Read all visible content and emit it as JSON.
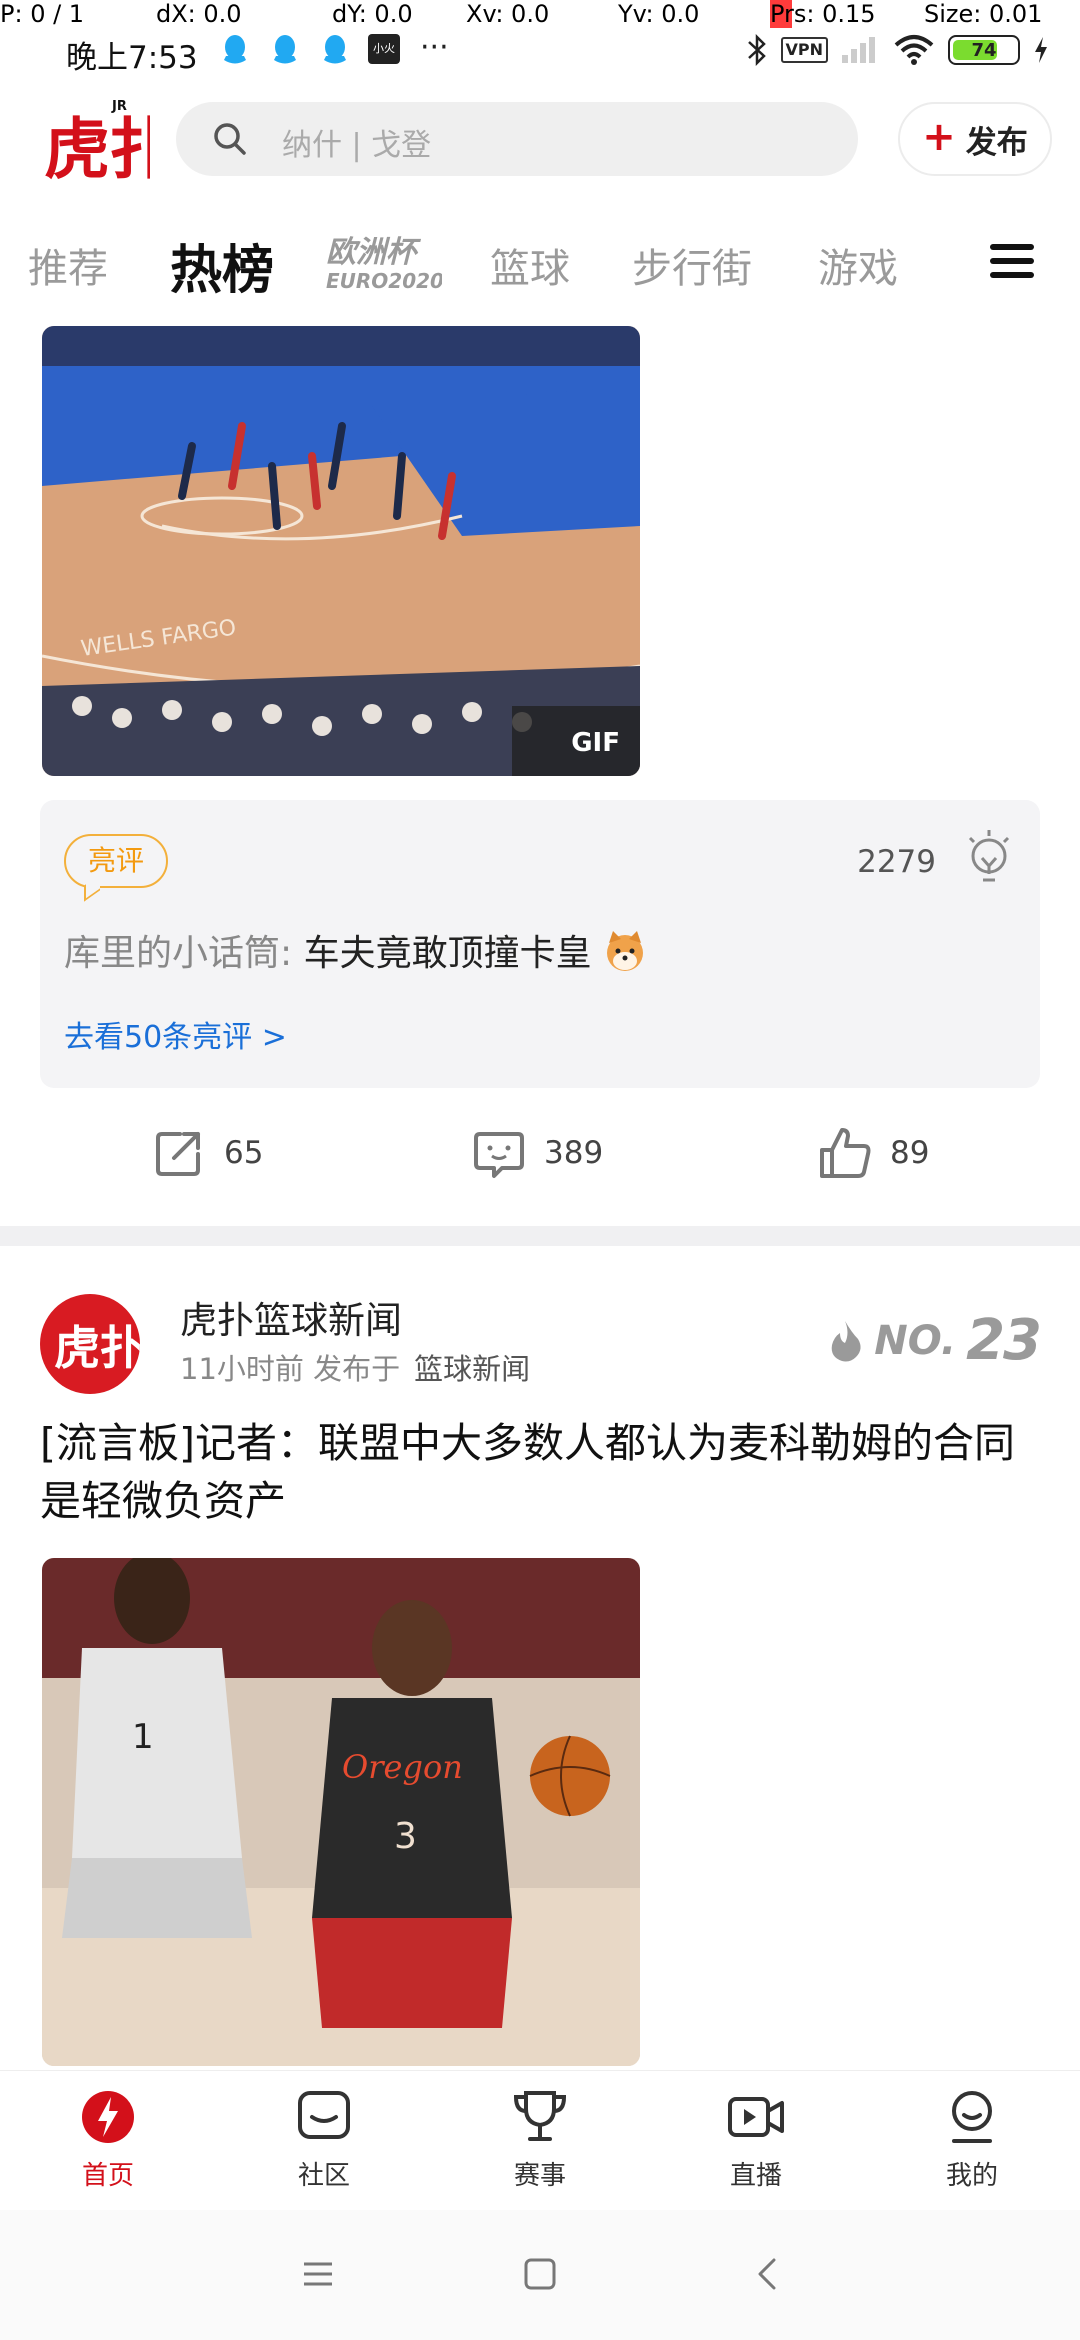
{
  "debug": {
    "p": "P: 0 / 1",
    "dx": "dX: 0.0",
    "dy": "dY: 0.0",
    "xv": "Xv: 0.0",
    "yv": "Yv: 0.0",
    "prs": "Prs: 0.15",
    "size": "Size: 0.01"
  },
  "status": {
    "time": "晚上7:53",
    "more": "···",
    "vpn": "VPN",
    "battery": "74",
    "battery_level": 0.74,
    "app_badge": "小火"
  },
  "header": {
    "logo_text": "虎扑",
    "logo_sup": "JR",
    "search_placeholder": "纳什 | 戈登",
    "publish_label": "发布",
    "publish_plus": "+"
  },
  "tabs": [
    {
      "label": "推荐",
      "active": false
    },
    {
      "label": "热榜",
      "active": true
    },
    {
      "label": "欧洲杯",
      "sub": "EURO2020",
      "active": false
    },
    {
      "label": "篮球",
      "active": false
    },
    {
      "label": "步行街",
      "active": false
    },
    {
      "label": "游戏",
      "active": false
    }
  ],
  "post1": {
    "gif_label": "GIF",
    "review": {
      "tag": "亮评",
      "count": "2279",
      "user": "库里的小话筒:",
      "text": "车夫竟敢顶撞卡皇",
      "more": "去看50条亮评 >"
    },
    "actions": {
      "share": "65",
      "comment": "389",
      "like": "89"
    }
  },
  "post2": {
    "author": "虎扑篮球新闻",
    "time": "11小时前 发布于",
    "board": "篮球新闻",
    "rank_prefix": "NO.",
    "rank_number": "23",
    "title": "[流言板]记者：联盟中大多数人都认为麦科勒姆的合同是轻微负资产"
  },
  "bottom_nav": [
    {
      "label": "首页",
      "icon": "home-bolt-icon",
      "active": true
    },
    {
      "label": "社区",
      "icon": "community-icon",
      "active": false
    },
    {
      "label": "赛事",
      "icon": "trophy-icon",
      "active": false
    },
    {
      "label": "直播",
      "icon": "live-video-icon",
      "active": false
    },
    {
      "label": "我的",
      "icon": "profile-icon",
      "active": false
    }
  ],
  "colors": {
    "brand_red": "#d3101a",
    "link_blue": "#1a6fd8",
    "tag_orange": "#f39a10"
  }
}
